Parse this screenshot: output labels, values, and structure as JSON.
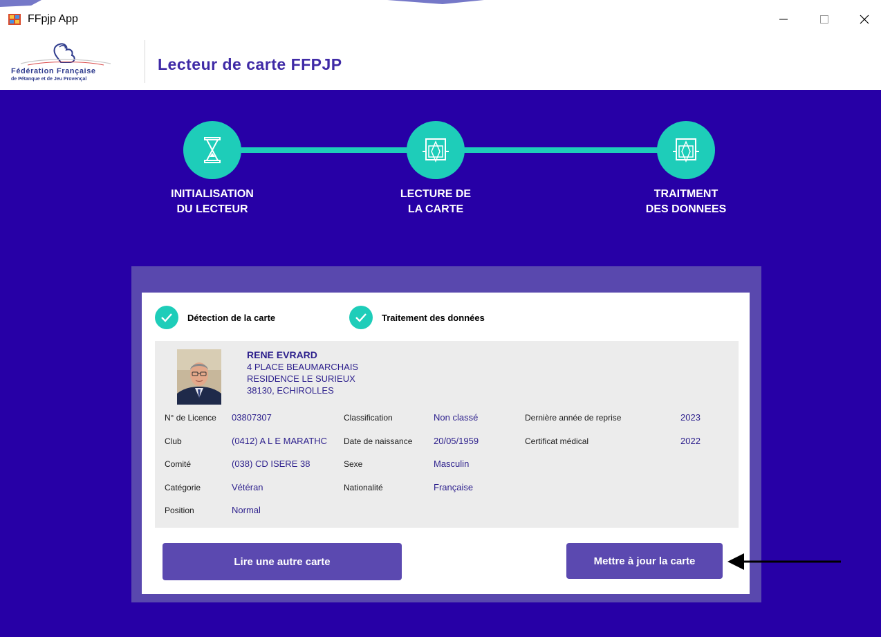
{
  "window": {
    "title": "FFpjp App"
  },
  "header": {
    "title": "Lecteur de carte FFPJP",
    "logo_line1": "Fédération Française",
    "logo_line2": "de Pétanque et de Jeu Provençal"
  },
  "steps": [
    {
      "line1": "INITIALISATION",
      "line2": "DU LECTEUR",
      "icon": "hourglass-icon"
    },
    {
      "line1": "LECTURE DE",
      "line2": "LA CARTE",
      "icon": "card-reader-icon"
    },
    {
      "line1": "TRAITMENT",
      "line2": "DES DONNEES",
      "icon": "card-reader-icon"
    }
  ],
  "status": {
    "detection": "Détection de la carte",
    "processing": "Traitement des données"
  },
  "player": {
    "name": "RENE EVRARD",
    "address1": "4 PLACE BEAUMARCHAIS",
    "address2": "RESIDENCE LE SURIEUX",
    "address3": "38130, ECHIROLLES"
  },
  "fields": {
    "licence_label": "N° de Licence",
    "licence_value": "03807307",
    "club_label": "Club",
    "club_value": "(0412) A L E  MARATHC",
    "comite_label": "Comité",
    "comite_value": "(038) CD ISERE 38",
    "categorie_label": "Catégorie",
    "categorie_value": "Vétéran",
    "position_label": "Position",
    "position_value": "Normal",
    "classification_label": "Classification",
    "classification_value": "Non classé",
    "naissance_label": "Date de naissance",
    "naissance_value": "20/05/1959",
    "sexe_label": "Sexe",
    "sexe_value": "Masculin",
    "nationalite_label": "Nationalité",
    "nationalite_value": "Française",
    "reprise_label": "Dernière année de reprise",
    "reprise_value": "2023",
    "certificat_label": "Certificat médical",
    "certificat_value": "2022"
  },
  "buttons": {
    "read_other": "Lire une autre carte",
    "update_card": "Mettre à jour la carte"
  },
  "colors": {
    "main_bg": "#2700a6",
    "accent": "#1ecdb9",
    "button": "#5b49b0"
  }
}
